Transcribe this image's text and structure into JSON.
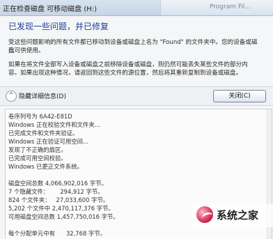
{
  "window": {
    "title": "正在检查磁盘 可移动磁盘 (H:)",
    "bg_title": "Program Fil..."
  },
  "summary": {
    "heading": "已发现一些问题，并已修复",
    "paragraph1": [
      "受这些问题影响的所有文件都已移动到设备或磁盘上名为 \"Found\" 的文件夹中。您的设备或磁盘",
      "已可供使用。"
    ],
    "paragraph2": [
      "如果在将文件全部写入设备或磁盘之前移除设备或磁盘，则仍然可能丢失某些文件的部分内",
      "容。如果出现这种情况，请返回到这些文件的源位置，然后将其重新复制到设备或磁盘。"
    ]
  },
  "toolbar": {
    "expander_glyph": "^",
    "details_toggle_label": "隐藏详细信息(D)",
    "close_label": "关闭(C)"
  },
  "details": {
    "lines": [
      "卷序列号为 6A42-E81D",
      "Windows 正在校验文件和文件夹...",
      "已完成文件和文件夹验证。",
      "Windows 正在验证可用空间...",
      "发现了不正确的扇区。",
      "已完成可用空间校验。",
      "Windows 已更正文件系统。",
      "",
      "磁盘空间总数 4,066,902,016 字节。",
      "7 个隐藏文件：      294,912 字节。",
      "824 个文件夹：   27,033,600 字节。",
      "5,202 个文件中 2,470,117,376 字节。",
      "可用磁盘空间总数 1,457,750,016 字节。",
      "",
      "每个分配单元中有      32,768 字节。"
    ]
  },
  "watermark": {
    "text": "系统之家"
  },
  "colors": {
    "heading": "#1c3f98",
    "title_bar": "#c6d5e5",
    "logo": "#d72f57"
  }
}
